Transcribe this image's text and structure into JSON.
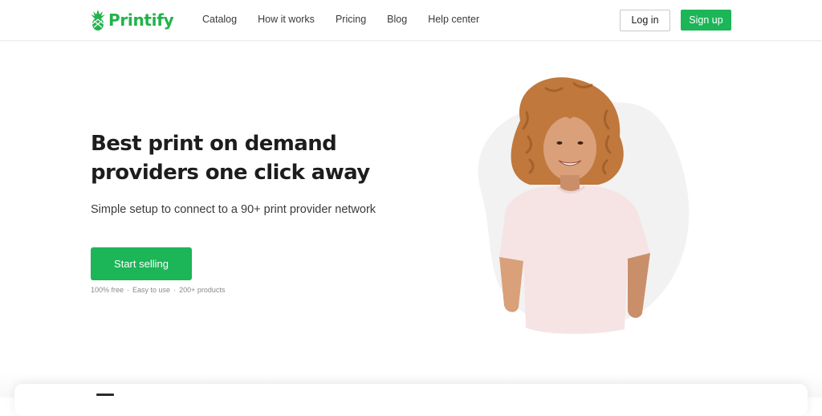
{
  "header": {
    "logo_text": "Printify",
    "logo_icon": "pineapple-logo-icon",
    "nav": [
      {
        "label": "Catalog"
      },
      {
        "label": "How it works"
      },
      {
        "label": "Pricing"
      },
      {
        "label": "Blog"
      },
      {
        "label": "Help center"
      }
    ],
    "login_label": "Log in",
    "signup_label": "Sign up"
  },
  "hero": {
    "title_line1": "Best print on demand",
    "title_line2": "providers one click away",
    "subtitle": "Simple setup to connect to a 90+ print provider network",
    "cta_label": "Start selling",
    "perks": [
      "100% free",
      "Easy to use",
      "200+ products"
    ],
    "perk_separator": "·"
  },
  "colors": {
    "brand_green": "#1cb557",
    "logo_green": "#22b34c",
    "blob_grey": "#f2f2f2"
  }
}
